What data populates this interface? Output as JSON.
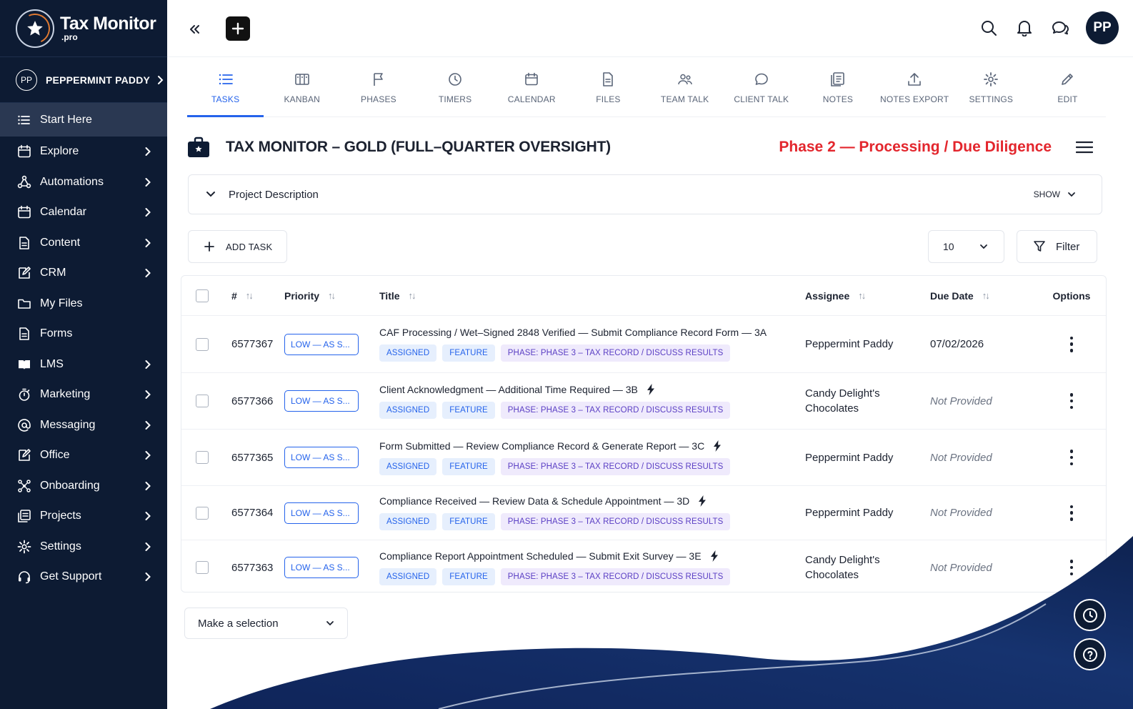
{
  "brand": {
    "name": "Tax Monitor",
    "suffix": ".pro"
  },
  "user": {
    "initials": "PP",
    "name": "PEPPERMINT PADDY"
  },
  "sidebar": {
    "items": [
      {
        "label": "Start Here",
        "icon": "list-icon",
        "active": true,
        "chevron": false
      },
      {
        "label": "Explore",
        "icon": "calendar-icon",
        "chevron": true
      },
      {
        "label": "Automations",
        "icon": "network-icon",
        "chevron": true
      },
      {
        "label": "Calendar",
        "icon": "calendar-icon",
        "chevron": true
      },
      {
        "label": "Content",
        "icon": "document-icon",
        "chevron": true
      },
      {
        "label": "CRM",
        "icon": "edit-icon",
        "chevron": true
      },
      {
        "label": "My Files",
        "icon": "folder-icon",
        "chevron": false
      },
      {
        "label": "Forms",
        "icon": "document-icon",
        "chevron": false
      },
      {
        "label": "LMS",
        "icon": "book-icon",
        "chevron": true
      },
      {
        "label": "Marketing",
        "icon": "stopwatch-icon",
        "chevron": true
      },
      {
        "label": "Messaging",
        "icon": "at-icon",
        "chevron": true
      },
      {
        "label": "Office",
        "icon": "edit-icon",
        "chevron": true
      },
      {
        "label": "Onboarding",
        "icon": "nodes-icon",
        "chevron": true
      },
      {
        "label": "Projects",
        "icon": "layers-icon",
        "chevron": true
      },
      {
        "label": "Settings",
        "icon": "gear-icon",
        "chevron": true
      },
      {
        "label": "Get Support",
        "icon": "headset-icon",
        "chevron": true
      }
    ]
  },
  "topbar": {
    "avatar": "PP"
  },
  "tabs": [
    {
      "label": "TASKS",
      "active": true
    },
    {
      "label": "KANBAN"
    },
    {
      "label": "PHASES"
    },
    {
      "label": "TIMERS"
    },
    {
      "label": "CALENDAR"
    },
    {
      "label": "FILES"
    },
    {
      "label": "TEAM TALK"
    },
    {
      "label": "CLIENT TALK"
    },
    {
      "label": "NOTES"
    },
    {
      "label": "NOTES EXPORT"
    },
    {
      "label": "SETTINGS"
    },
    {
      "label": "EDIT"
    }
  ],
  "project": {
    "title": "TAX MONITOR – GOLD (FULL–QUARTER OVERSIGHT)",
    "phase": "Phase 2 — Processing / Due Diligence",
    "description_label": "Project Description",
    "show_label": "SHOW"
  },
  "toolbar": {
    "add_task": "ADD TASK",
    "page_size": "10",
    "filter": "Filter"
  },
  "table": {
    "headers": {
      "num": "#",
      "priority": "Priority",
      "title": "Title",
      "assignee": "Assignee",
      "due": "Due Date",
      "options": "Options"
    },
    "rows": [
      {
        "id": "6577367",
        "priority": "LOW — AS S...",
        "title": "CAF Processing / Wet–Signed 2848 Verified — Submit Compliance Record Form — 3A",
        "bolt": false,
        "tags": [
          "ASSIGNED",
          "FEATURE",
          "PHASE: PHASE 3 – TAX RECORD / DISCUSS RESULTS"
        ],
        "assignee": "Peppermint Paddy",
        "due": "07/02/2026",
        "due_missing": false
      },
      {
        "id": "6577366",
        "priority": "LOW — AS S...",
        "title": "Client Acknowledgment — Additional Time Required — 3B",
        "bolt": true,
        "tags": [
          "ASSIGNED",
          "FEATURE",
          "PHASE: PHASE 3 – TAX RECORD / DISCUSS RESULTS"
        ],
        "assignee": "Candy Delight's Chocolates",
        "due": "Not Provided",
        "due_missing": true
      },
      {
        "id": "6577365",
        "priority": "LOW — AS S...",
        "title": "Form Submitted — Review Compliance Record & Generate Report — 3C",
        "bolt": true,
        "tags": [
          "ASSIGNED",
          "FEATURE",
          "PHASE: PHASE 3 – TAX RECORD / DISCUSS RESULTS"
        ],
        "assignee": "Peppermint Paddy",
        "due": "Not Provided",
        "due_missing": true
      },
      {
        "id": "6577364",
        "priority": "LOW — AS S...",
        "title": "Compliance Received — Review Data & Schedule Appointment — 3D",
        "bolt": true,
        "tags": [
          "ASSIGNED",
          "FEATURE",
          "PHASE: PHASE 3 – TAX RECORD / DISCUSS RESULTS"
        ],
        "assignee": "Peppermint Paddy",
        "due": "Not Provided",
        "due_missing": true
      },
      {
        "id": "6577363",
        "priority": "LOW — AS S...",
        "title": "Compliance Report Appointment Scheduled — Submit Exit Survey — 3E",
        "bolt": true,
        "tags": [
          "ASSIGNED",
          "FEATURE",
          "PHASE: PHASE 3 – TAX RECORD / DISCUSS RESULTS"
        ],
        "assignee": "Candy Delight's Chocolates",
        "due": "Not Provided",
        "due_missing": true
      }
    ]
  },
  "bulk_select": {
    "placeholder": "Make a selection"
  },
  "colors": {
    "navy": "#0d1b33",
    "accent": "#2563eb",
    "phase_red": "#e3262d",
    "tag_purple": "#5b3fc4"
  }
}
